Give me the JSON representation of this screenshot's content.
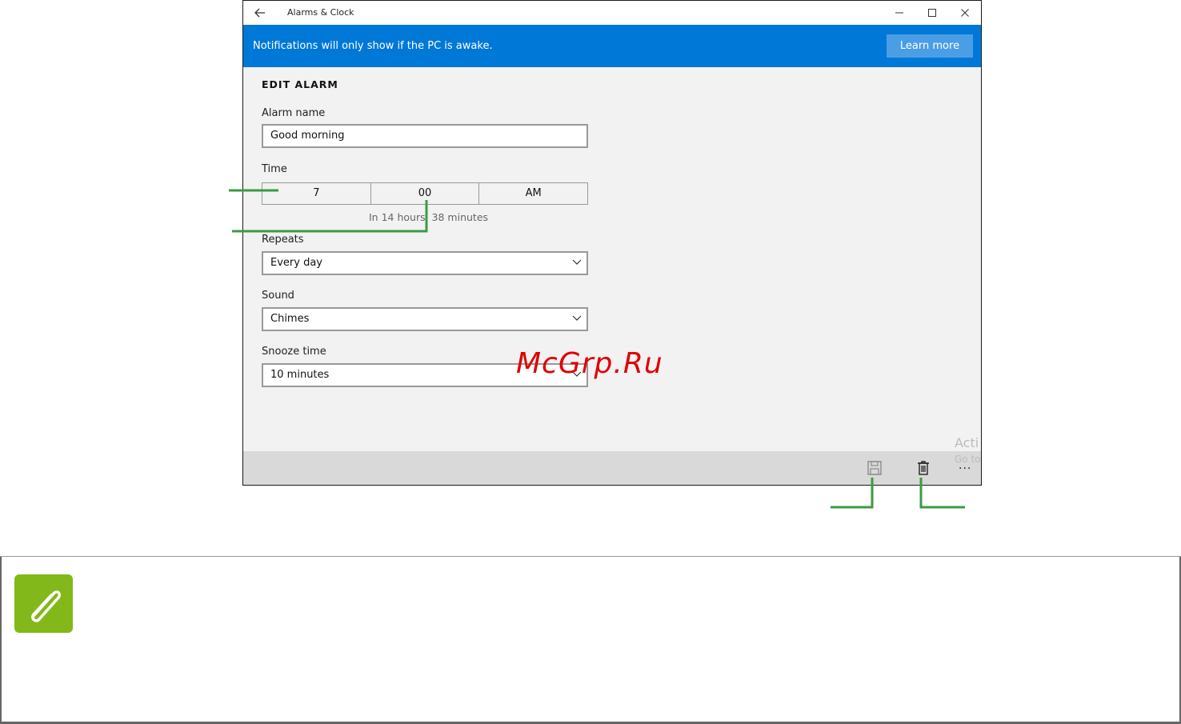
{
  "window": {
    "title": "Alarms & Clock",
    "accent_color": "#0078d7"
  },
  "banner": {
    "message": "Notifications will only show if the PC is awake.",
    "learn_more": "Learn more"
  },
  "form": {
    "heading": "EDIT ALARM",
    "alarm_name_label": "Alarm name",
    "alarm_name_value": "Good morning",
    "time_label": "Time",
    "time_hour": "7",
    "time_minute": "00",
    "time_ampm": "AM",
    "time_hint": "In 14 hours, 38 minutes",
    "repeats_label": "Repeats",
    "repeats_value": "Every day",
    "sound_label": "Sound",
    "sound_value": "Chimes",
    "snooze_label": "Snooze time",
    "snooze_value": "10 minutes"
  },
  "appbar": {
    "save_icon": "save-icon",
    "delete_icon": "delete-icon",
    "more_label": "..."
  },
  "overlay": {
    "watermark": "McGrp.Ru",
    "activate_title": "Acti",
    "activate_sub": "Go to"
  },
  "callout_color": "#3c9a45",
  "note": {
    "icon": "paperclip-icon",
    "icon_color": "#83b81a"
  }
}
